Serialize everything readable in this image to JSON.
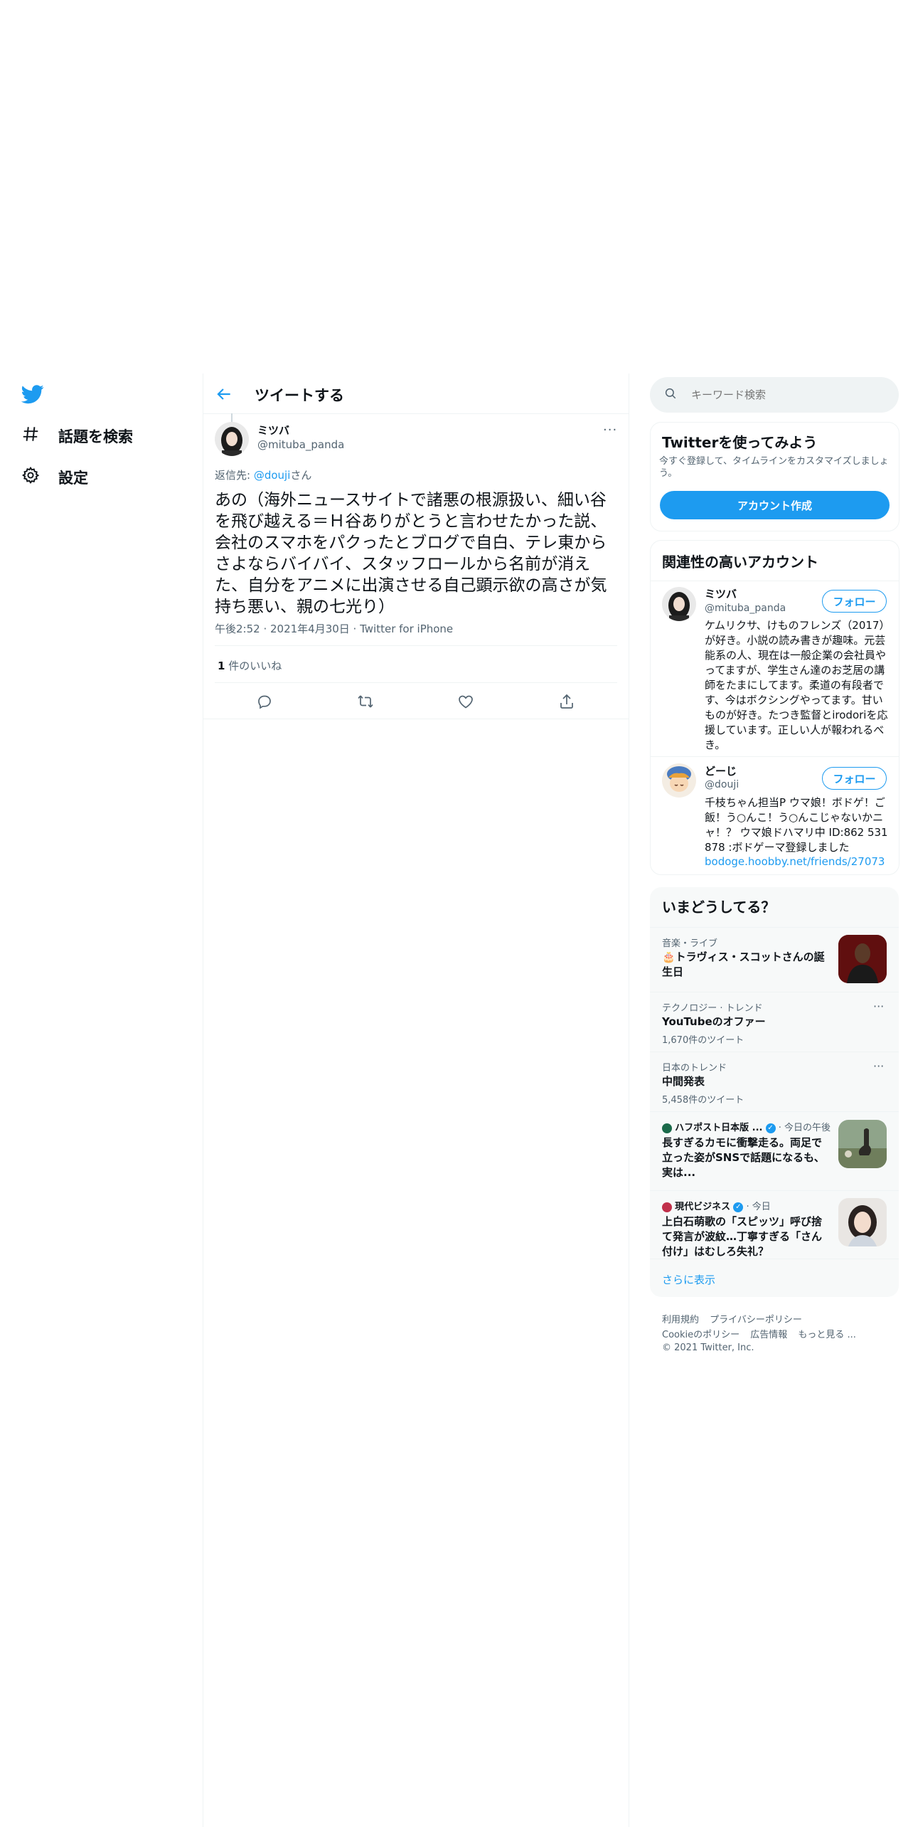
{
  "colors": {
    "accent": "#1d9bf0",
    "text": "#0f1419",
    "secondary": "#536471",
    "border": "#eff3f4"
  },
  "nav": {
    "logo_icon": "twitter-bird-icon",
    "items": [
      {
        "icon": "hashtag-icon",
        "label": "話題を検索"
      },
      {
        "icon": "gear-icon",
        "label": "設定"
      }
    ]
  },
  "header": {
    "back_icon": "arrow-left-icon",
    "title": "ツイートする"
  },
  "tweet": {
    "name": "ミツバ",
    "handle": "@mituba_panda",
    "more_icon": "more-dots-icon",
    "reply_prefix": "返信先: ",
    "reply_mention": "@douji",
    "reply_suffix": "さん",
    "text": "あの（海外ニュースサイトで諸悪の根源扱い、細い谷を飛び越える＝Ｈ谷ありがとうと言わせたかった説、会社のスマホをパクったとブログで自白、テレ東からさよならバイバイ、スタッフロールから名前が消えた、自分をアニメに出演させる自己顕示欲の高さが気持ち悪い、親の七光り）",
    "meta": "午後2:52 · 2021年4月30日 · Twitter for iPhone",
    "likes_count": "1",
    "likes_label": " 件のいいね",
    "actions": [
      "reply-icon",
      "retweet-icon",
      "like-icon",
      "share-icon"
    ]
  },
  "search": {
    "placeholder": "キーワード検索"
  },
  "signup": {
    "title": "Twitterを使ってみよう",
    "subtitle": "今すぐ登録して、タイムラインをカスタマイズしましょう。",
    "button": "アカウント作成"
  },
  "relevant": {
    "title": "関連性の高いアカウント",
    "follow_label": "フォロー",
    "accounts": [
      {
        "name": "ミツバ",
        "handle": "@mituba_panda",
        "bio": "ケムリクサ、けものフレンズ（2017）が好き。小説の読み書きが趣味。元芸能系の人、現在は一般企業の会社員やってますが、学生さん達のお芝居の講師をたまにしてます。柔道の有段者です、今はボクシングやってます。甘いものが好き。たつき監督とirodoriを応援しています。正しい人が報われるべき。",
        "link": ""
      },
      {
        "name": "どーじ",
        "handle": "@douji",
        "bio": "千枝ちゃん担当P ウマ娘！ボドゲ！ご飯！う○んこ！う○んこじゃないかニャ！？ ウマ娘ドハマリ中 ID:862 531 878 :ボドゲーマ登録しました",
        "link": "bodoge.hoobby.net/friends/27073"
      }
    ]
  },
  "trends": {
    "title": "いまどうしてる？",
    "items": [
      {
        "category": "音楽・ライブ",
        "title": "🎂トラヴィス・スコットさんの誕生日",
        "count": ""
      },
      {
        "category": "テクノロジー · トレンド",
        "title": "YouTubeのオファー",
        "count": "1,670件のツイート"
      },
      {
        "category": "日本のトレンド",
        "title": "中間発表",
        "count": "5,458件のツイート"
      },
      {
        "source": "ハフポスト日本版 ...",
        "time": "· 今日の午後",
        "title": "長すぎるカモに衝撃走る。両足で立った姿がSNSで話題になるも、実は..."
      },
      {
        "source": "現代ビジネス",
        "time": "· 今日",
        "title": "上白石萌歌の「スピッツ」呼び捨て発言が波紋…丁寧すぎる「さん付け」はむしろ失礼？"
      }
    ],
    "show_more": "さらに表示"
  },
  "footer": {
    "links_row1": [
      "利用規約",
      "プライバシーポリシー"
    ],
    "links_row2": [
      "Cookieのポリシー",
      "広告情報",
      "もっと見る ..."
    ],
    "copyright": "© 2021 Twitter, Inc."
  }
}
